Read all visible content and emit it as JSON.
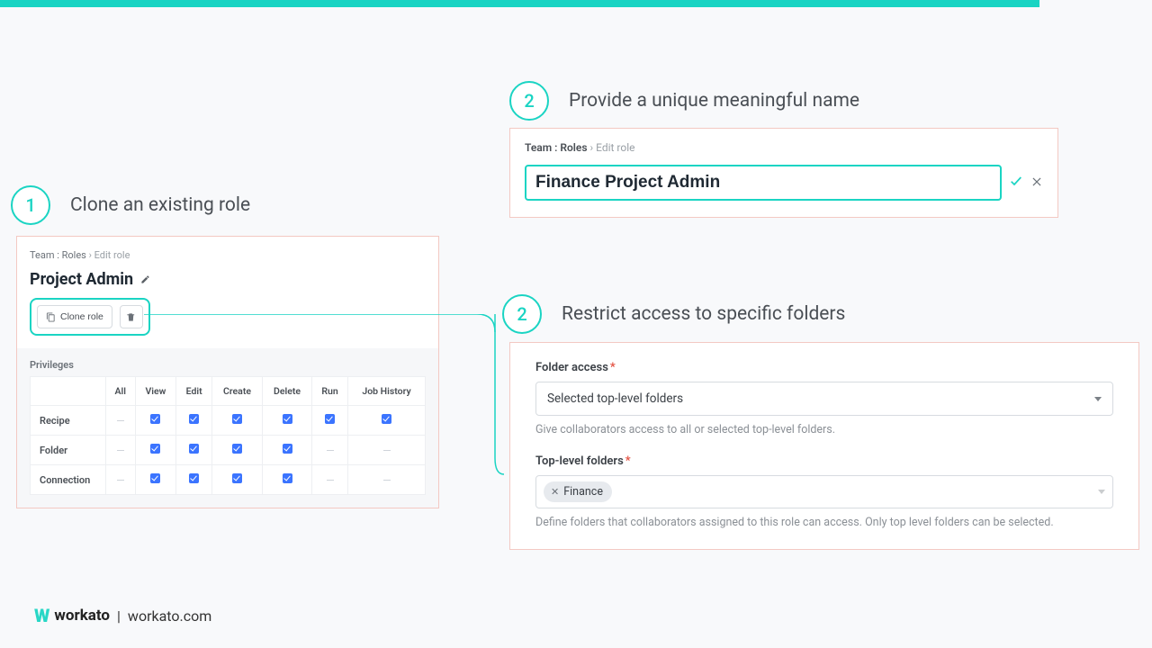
{
  "top_bar_color": "#1ad4c3",
  "step1": {
    "badge": "1",
    "title": "Clone an existing role",
    "breadcrumb": {
      "a": "Team : Roles",
      "sep": "›",
      "b": "Edit role"
    },
    "role_name": "Project Admin",
    "clone_button": "Clone role",
    "privileges_label": "Privileges",
    "columns": [
      "All",
      "View",
      "Edit",
      "Create",
      "Delete",
      "Run",
      "Job History"
    ],
    "rows": [
      {
        "label": "Recipe",
        "cells": [
          "dash",
          "check",
          "check",
          "check",
          "check",
          "check",
          "check"
        ]
      },
      {
        "label": "Folder",
        "cells": [
          "dash",
          "check",
          "check",
          "check",
          "check",
          "dash",
          "dash"
        ]
      },
      {
        "label": "Connection",
        "cells": [
          "dash",
          "check",
          "check",
          "check",
          "check",
          "dash",
          "dash"
        ]
      }
    ]
  },
  "step2a": {
    "badge": "2",
    "title": "Provide a unique meaningful name",
    "breadcrumb": {
      "a": "Team : Roles",
      "sep": "›",
      "b": "Edit role"
    },
    "name_value": "Finance Project Admin"
  },
  "step2b": {
    "badge": "2",
    "title": "Restrict access to specific folders",
    "folder_access_label": "Folder access",
    "folder_access_value": "Selected top-level folders",
    "folder_access_help": "Give collaborators access to all or selected top-level folders.",
    "top_folders_label": "Top-level folders",
    "chip": "Finance",
    "top_folders_help": "Define folders that collaborators assigned to this role can access. Only top level folders can be selected."
  },
  "footer": {
    "brand": "workato",
    "domain": "workato.com"
  }
}
